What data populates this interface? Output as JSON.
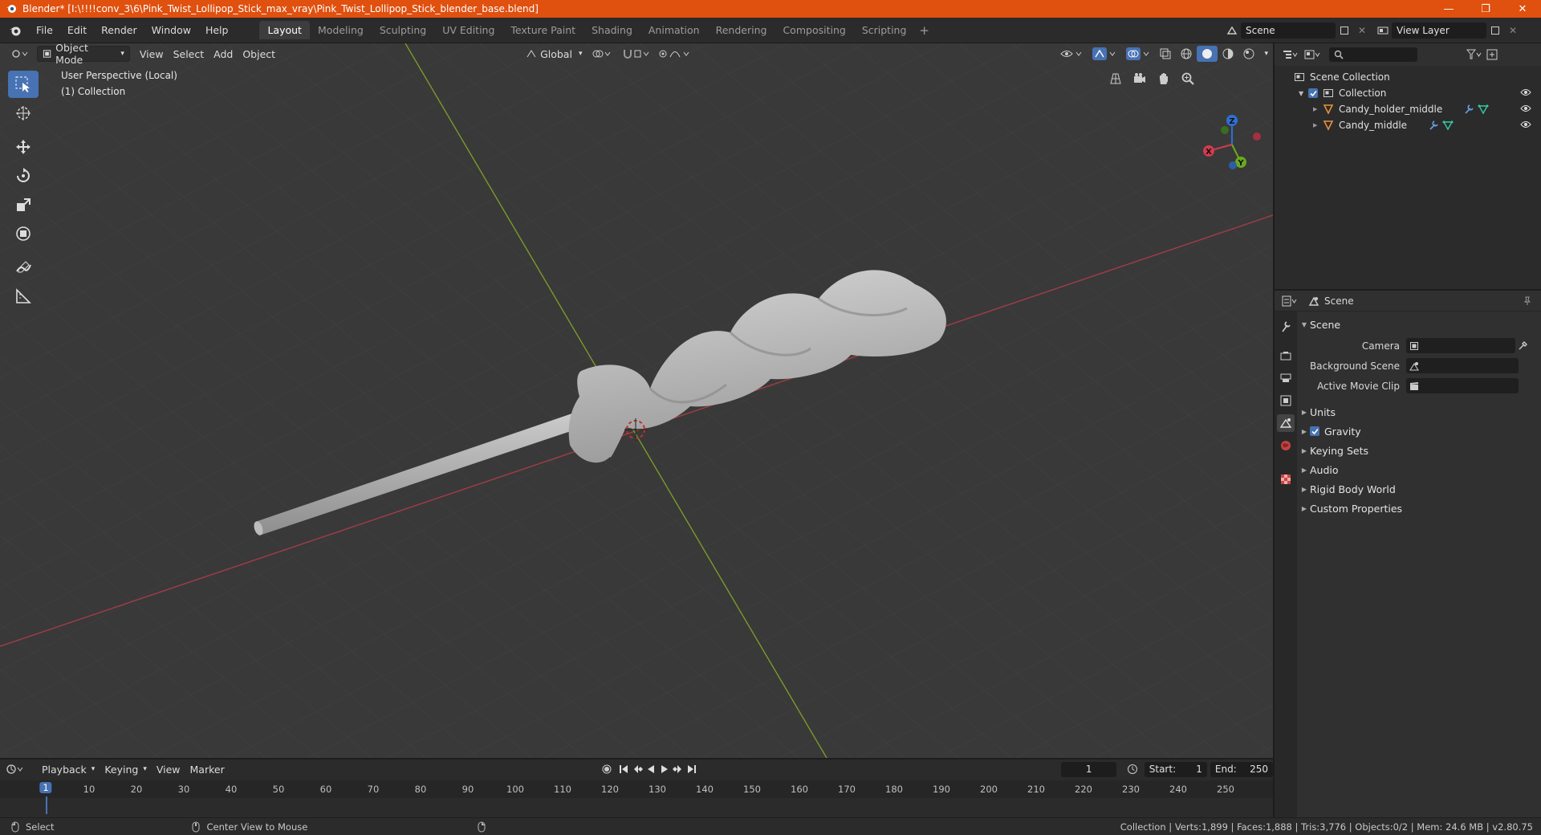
{
  "window": {
    "title": "Blender* [I:\\!!!!conv_3\\6\\Pink_Twist_Lollipop_Stick_max_vray\\Pink_Twist_Lollipop_Stick_blender_base.blend]",
    "minimize": "—",
    "maximize": "❐",
    "close": "✕"
  },
  "menu": [
    "File",
    "Edit",
    "Render",
    "Window",
    "Help"
  ],
  "workspaces": [
    "Layout",
    "Modeling",
    "Sculpting",
    "UV Editing",
    "Texture Paint",
    "Shading",
    "Animation",
    "Rendering",
    "Compositing",
    "Scripting"
  ],
  "workspace_add": "+",
  "scene_name": "Scene",
  "view_layer": "View Layer",
  "viewport": {
    "mode": "Object Mode",
    "menus": [
      "View",
      "Select",
      "Add",
      "Object"
    ],
    "orientation": "Global",
    "info_line1": "User Perspective (Local)",
    "info_line2": "(1) Collection"
  },
  "gizmo": {
    "x": "X",
    "y": "Y",
    "z": "Z"
  },
  "outliner": {
    "root": "Scene Collection",
    "collection": "Collection",
    "objects": [
      "Candy_holder_middle",
      "Candy_middle"
    ]
  },
  "properties": {
    "header": "Scene",
    "panel": "Scene",
    "camera_label": "Camera",
    "background_label": "Background Scene",
    "movieclip_label": "Active Movie Clip",
    "sections": [
      "Units",
      "Gravity",
      "Keying Sets",
      "Audio",
      "Rigid Body World",
      "Custom Properties"
    ]
  },
  "timeline": {
    "menus": [
      "Playback",
      "Keying",
      "View",
      "Marker"
    ],
    "current_frame": "1",
    "start_label": "Start:",
    "start": "1",
    "end_label": "End:",
    "end": "250",
    "ticks": [
      "10",
      "20",
      "30",
      "40",
      "50",
      "60",
      "70",
      "80",
      "90",
      "100",
      "110",
      "120",
      "130",
      "140",
      "150",
      "160",
      "170",
      "180",
      "190",
      "200",
      "210",
      "220",
      "230",
      "240",
      "250"
    ]
  },
  "status": {
    "select": "Select",
    "center": "Center View to Mouse",
    "stats": "Collection | Verts:1,899 | Faces:1,888 | Tris:3,776 | Objects:0/2 | Mem: 24.6 MB | v2.80.75"
  }
}
